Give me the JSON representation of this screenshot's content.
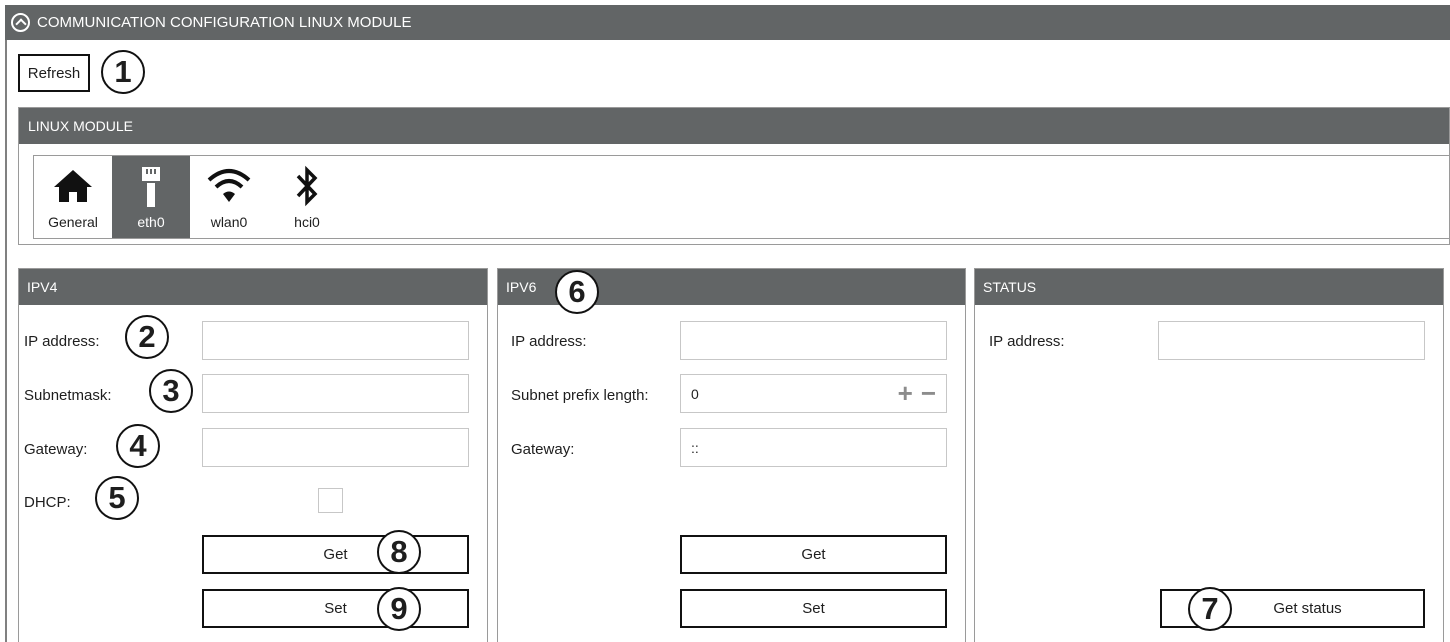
{
  "window": {
    "title": "COMMUNICATION CONFIGURATION LINUX MODULE"
  },
  "toolbar": {
    "refresh_label": "Refresh"
  },
  "linux_module": {
    "title": "LINUX MODULE",
    "interfaces": [
      {
        "label": "General",
        "icon": "home-icon",
        "selected": false
      },
      {
        "label": "eth0",
        "icon": "ethernet-icon",
        "selected": true
      },
      {
        "label": "wlan0",
        "icon": "wifi-icon",
        "selected": false
      },
      {
        "label": "hci0",
        "icon": "bluetooth-icon",
        "selected": false
      }
    ]
  },
  "ipv4": {
    "title": "IPV4",
    "ip_label": "IP address:",
    "ip_value": "",
    "subnet_label": "Subnetmask:",
    "subnet_value": "",
    "gateway_label": "Gateway:",
    "gateway_value": "",
    "dhcp_label": "DHCP:",
    "dhcp_checked": false,
    "get_label": "Get",
    "set_label": "Set"
  },
  "ipv6": {
    "title": "IPV6",
    "ip_label": "IP address:",
    "ip_value": "",
    "prefix_label": "Subnet prefix length:",
    "prefix_value": "0",
    "plus": "+",
    "minus": "−",
    "gateway_label": "Gateway:",
    "gateway_value": "::",
    "get_label": "Get",
    "set_label": "Set"
  },
  "status": {
    "title": "STATUS",
    "ip_label": "IP address:",
    "ip_value": "",
    "get_status_label": "Get status"
  },
  "callouts": [
    "1",
    "2",
    "3",
    "4",
    "5",
    "6",
    "7",
    "8",
    "9"
  ],
  "colors": {
    "header_bg": "#626566",
    "border": "#9a9a9a",
    "field_border": "#c7c7c7"
  }
}
